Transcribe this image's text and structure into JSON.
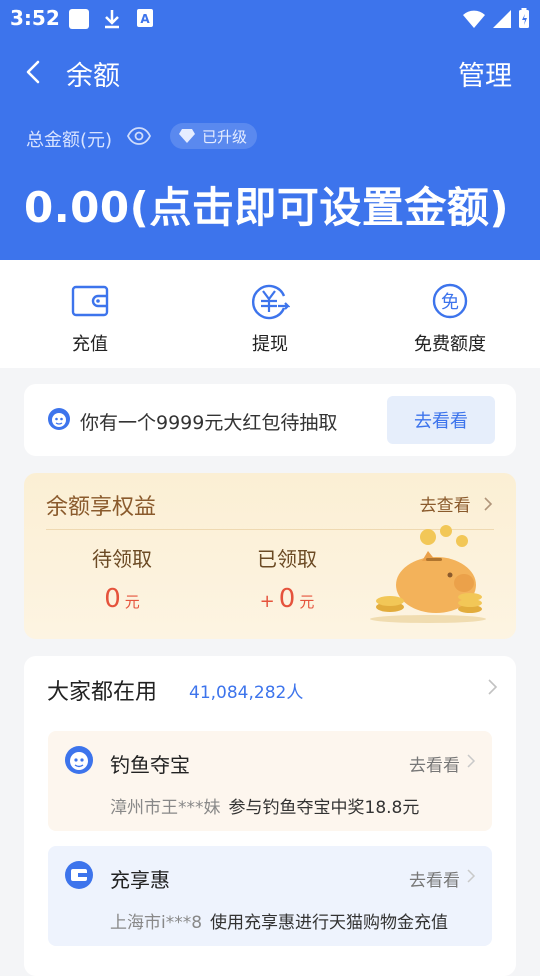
{
  "status_bar": {
    "time": "3:52"
  },
  "header": {
    "title": "余额",
    "manage_label": "管理",
    "total_label": "总金额(元)",
    "badge_label": "已升级",
    "amount_text": "0.00(点击即可设置金额)"
  },
  "actions": [
    {
      "label": "充值",
      "icon": "wallet-icon"
    },
    {
      "label": "提现",
      "icon": "yuan-withdraw-icon"
    },
    {
      "label": "免费额度",
      "icon": "free-quota-icon"
    }
  ],
  "promo": {
    "text": "你有一个9999元大红包待抽取",
    "button_label": "去看看"
  },
  "rights": {
    "title": "余额享权益",
    "link_label": "去查看",
    "pending_label": "待领取",
    "pending_value": "0",
    "pending_unit": "元",
    "received_label": "已领取",
    "received_prefix": "+",
    "received_value": "0",
    "received_unit": "元"
  },
  "users": {
    "title": "大家都在用",
    "count": "41,084,282人",
    "items": [
      {
        "name": "钓鱼夺宝",
        "link_label": "去看看",
        "who": "漳州市王***妹",
        "desc": "参与钓鱼夺宝中奖18.8元",
        "bg": "#fdf6ee"
      },
      {
        "name": "充享惠",
        "link_label": "去看看",
        "who": "上海市i***8",
        "desc": "使用充享惠进行天猫购物金充值",
        "bg": "#eef3fd"
      }
    ]
  },
  "colors": {
    "primary": "#3d74ec",
    "accent_red": "#e5533c",
    "gold_text": "#8a5a2c"
  }
}
